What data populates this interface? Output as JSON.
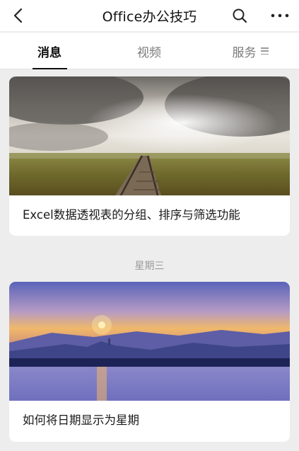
{
  "header": {
    "title": "Office办公技巧"
  },
  "tabs": [
    {
      "label": "消息",
      "active": true
    },
    {
      "label": "视频",
      "active": false
    },
    {
      "label": "服务",
      "active": false
    }
  ],
  "articles": [
    {
      "title": "Excel数据透视表的分组、排序与筛选功能"
    },
    {
      "title": "如何将日期显示为星期"
    }
  ],
  "date_separator": "星期三",
  "colors": {
    "background": "#ededed",
    "card": "#ffffff",
    "text_primary": "#111111",
    "text_secondary": "#7a7a7a"
  }
}
